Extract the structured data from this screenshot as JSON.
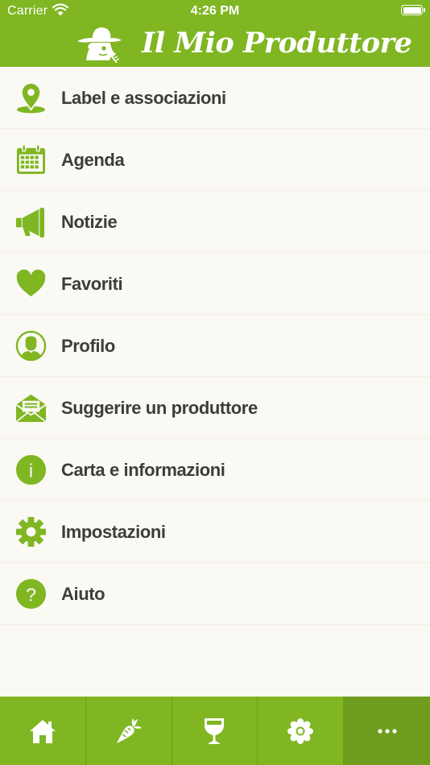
{
  "status_bar": {
    "carrier": "Carrier",
    "time": "4:26 PM",
    "icons": [
      "wifi-icon",
      "battery-icon"
    ]
  },
  "header": {
    "title": "Il Mio Produttore",
    "logo": "farmer-logo-icon",
    "color": "#7fb622"
  },
  "menu": {
    "items": [
      {
        "label": "Label e associazioni",
        "icon": "location-pin-icon"
      },
      {
        "label": "Agenda",
        "icon": "calendar-icon"
      },
      {
        "label": "Notizie",
        "icon": "megaphone-icon"
      },
      {
        "label": "Favoriti",
        "icon": "heart-icon"
      },
      {
        "label": "Profilo",
        "icon": "profile-icon"
      },
      {
        "label": "Suggerire un produttore",
        "icon": "envelope-icon"
      },
      {
        "label": "Carta e informazioni",
        "icon": "info-icon"
      },
      {
        "label": "Impostazioni",
        "icon": "gear-icon"
      },
      {
        "label": "Aiuto",
        "icon": "help-icon"
      }
    ]
  },
  "tab_bar": {
    "tabs": [
      {
        "icon": "home-icon",
        "selected": false
      },
      {
        "icon": "carrot-icon",
        "selected": false
      },
      {
        "icon": "wine-glass-icon",
        "selected": false
      },
      {
        "icon": "flower-icon",
        "selected": false
      },
      {
        "icon": "more-icon",
        "selected": true
      }
    ]
  },
  "colors": {
    "brand_green": "#7fb622",
    "active_tab": "#6e9d1e",
    "background": "#faf9f3",
    "text": "#3d3d3d"
  }
}
